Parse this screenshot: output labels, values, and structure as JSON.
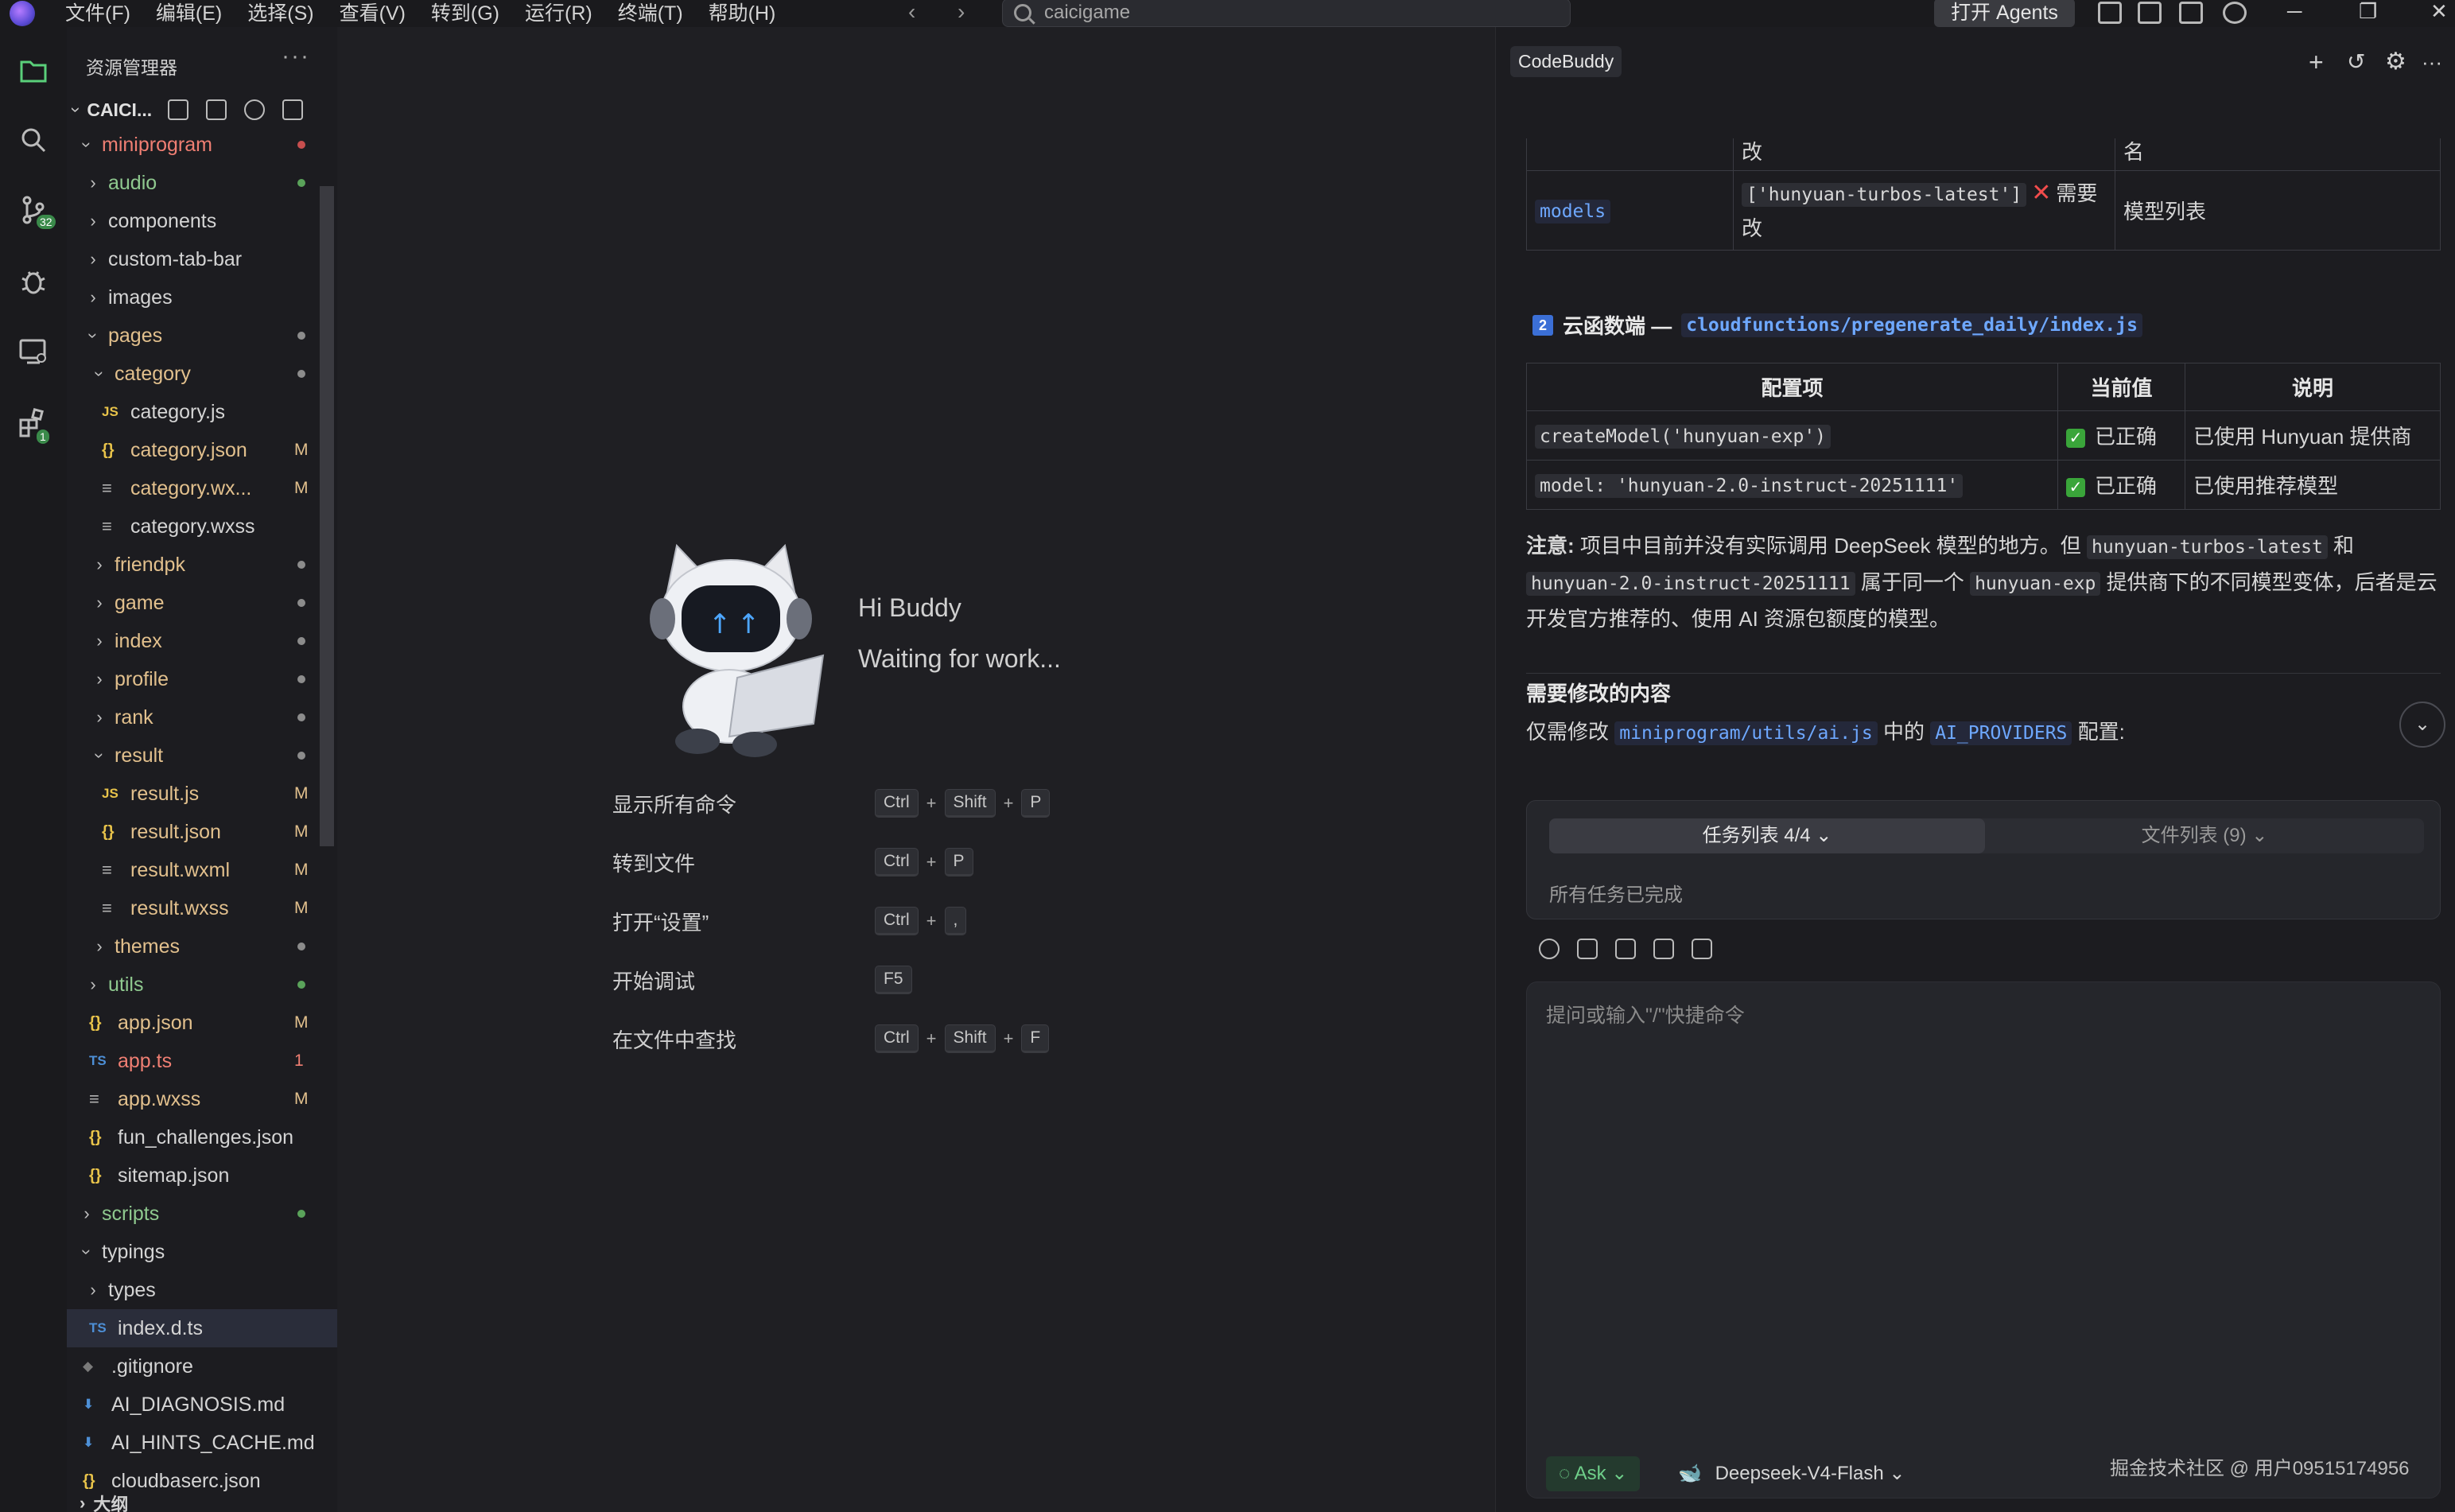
{
  "menu": [
    "文件(F)",
    "编辑(E)",
    "选择(S)",
    "查看(V)",
    "转到(G)",
    "运行(R)",
    "终端(T)",
    "帮助(H)"
  ],
  "search": {
    "text": "caicigame"
  },
  "agents_button": "打开 Agents",
  "activity": {
    "scm_badge": "32",
    "ext_badge": "1"
  },
  "explorer": {
    "title": "资源管理器",
    "project": "CAICI...",
    "outline": "大纲",
    "items": [
      {
        "label": "miniprogram",
        "depth": 1,
        "kind": "folder",
        "open": true,
        "color": "err",
        "mark": "dot-red"
      },
      {
        "label": "audio",
        "depth": 2,
        "kind": "folder",
        "color": "green",
        "mark": "dot-green"
      },
      {
        "label": "components",
        "depth": 2,
        "kind": "folder"
      },
      {
        "label": "custom-tab-bar",
        "depth": 2,
        "kind": "folder"
      },
      {
        "label": "images",
        "depth": 2,
        "kind": "folder"
      },
      {
        "label": "pages",
        "depth": 2,
        "kind": "folder",
        "open": true,
        "color": "mod",
        "mark": "dot"
      },
      {
        "label": "category",
        "depth": 3,
        "kind": "folder",
        "open": true,
        "color": "mod",
        "mark": "dot"
      },
      {
        "label": "category.js",
        "depth": 4,
        "kind": "js",
        "icon": "JS"
      },
      {
        "label": "category.json",
        "depth": 4,
        "kind": "json",
        "icon": "{}",
        "color": "mod",
        "status": "M"
      },
      {
        "label": "category.wx...",
        "depth": 4,
        "kind": "wx",
        "icon": "≡",
        "color": "mod",
        "status": "M"
      },
      {
        "label": "category.wxss",
        "depth": 4,
        "kind": "wx",
        "icon": "≡"
      },
      {
        "label": "friendpk",
        "depth": 3,
        "kind": "folder",
        "color": "mod",
        "mark": "dot"
      },
      {
        "label": "game",
        "depth": 3,
        "kind": "folder",
        "color": "mod",
        "mark": "dot"
      },
      {
        "label": "index",
        "depth": 3,
        "kind": "folder",
        "color": "mod",
        "mark": "dot"
      },
      {
        "label": "profile",
        "depth": 3,
        "kind": "folder",
        "color": "mod",
        "mark": "dot"
      },
      {
        "label": "rank",
        "depth": 3,
        "kind": "folder",
        "color": "mod",
        "mark": "dot"
      },
      {
        "label": "result",
        "depth": 3,
        "kind": "folder",
        "open": true,
        "color": "mod",
        "mark": "dot"
      },
      {
        "label": "result.js",
        "depth": 4,
        "kind": "js",
        "icon": "JS",
        "color": "mod",
        "status": "M"
      },
      {
        "label": "result.json",
        "depth": 4,
        "kind": "json",
        "icon": "{}",
        "color": "mod",
        "status": "M"
      },
      {
        "label": "result.wxml",
        "depth": 4,
        "kind": "wx",
        "icon": "≡",
        "color": "mod",
        "status": "M"
      },
      {
        "label": "result.wxss",
        "depth": 4,
        "kind": "wx",
        "icon": "≡",
        "color": "mod",
        "status": "M"
      },
      {
        "label": "themes",
        "depth": 3,
        "kind": "folder",
        "color": "mod",
        "mark": "dot"
      },
      {
        "label": "utils",
        "depth": 2,
        "kind": "folder",
        "color": "green",
        "mark": "dot-green"
      },
      {
        "label": "app.json",
        "depth": 2,
        "kind": "json",
        "icon": "{}",
        "color": "mod",
        "status": "M"
      },
      {
        "label": "app.ts",
        "depth": 2,
        "kind": "ts",
        "icon": "TS",
        "color": "err",
        "status": "1"
      },
      {
        "label": "app.wxss",
        "depth": 2,
        "kind": "wx",
        "icon": "≡",
        "color": "mod",
        "status": "M"
      },
      {
        "label": "fun_challenges.json",
        "depth": 2,
        "kind": "json",
        "icon": "{}"
      },
      {
        "label": "sitemap.json",
        "depth": 2,
        "kind": "json",
        "icon": "{}"
      },
      {
        "label": "scripts",
        "depth": 1,
        "kind": "folder",
        "color": "green",
        "mark": "dot-green"
      },
      {
        "label": "typings",
        "depth": 1,
        "kind": "folder",
        "open": true
      },
      {
        "label": "types",
        "depth": 2,
        "kind": "folder"
      },
      {
        "label": "index.d.ts",
        "depth": 2,
        "kind": "ts",
        "icon": "TS",
        "selected": true
      },
      {
        "label": ".gitignore",
        "depth": 1,
        "kind": "git",
        "icon": "◆"
      },
      {
        "label": "AI_DIAGNOSIS.md",
        "depth": 1,
        "kind": "md",
        "icon": "⬇"
      },
      {
        "label": "AI_HINTS_CACHE.md",
        "depth": 1,
        "kind": "md",
        "icon": "⬇"
      },
      {
        "label": "cloudbaserc.json",
        "depth": 1,
        "kind": "json",
        "icon": "{}"
      }
    ]
  },
  "welcome": {
    "greeting": "Hi Buddy",
    "status": "Waiting for work...",
    "shortcuts": [
      {
        "label": "显示所有命令",
        "keys": [
          "Ctrl",
          "Shift",
          "P"
        ]
      },
      {
        "label": "转到文件",
        "keys": [
          "Ctrl",
          "P"
        ]
      },
      {
        "label": "打开“设置”",
        "keys": [
          "Ctrl",
          ","
        ]
      },
      {
        "label": "开始调试",
        "keys": [
          "F5"
        ]
      },
      {
        "label": "在文件中查找",
        "keys": [
          "Ctrl",
          "Shift",
          "F"
        ]
      }
    ]
  },
  "panel": {
    "tab": "CodeBuddy",
    "table1": {
      "row_top": {
        "c2": "改",
        "c3": "名"
      },
      "row_models": {
        "key": "models",
        "value": "['hunyuan-turbos-latest']",
        "note": "需要改",
        "desc": "模型列表"
      }
    },
    "sec2": {
      "num": "2",
      "title": "云函数端 —",
      "path": "cloudfunctions/pregenerate_daily/index.js"
    },
    "table2": {
      "headers": [
        "配置项",
        "当前值",
        "说明"
      ],
      "rows": [
        {
          "item": "createModel('hunyuan-exp')",
          "value": "已正确",
          "desc": "已使用 Hunyuan 提供商"
        },
        {
          "item": "model: 'hunyuan-2.0-instruct-20251111'",
          "value": "已正确",
          "desc": "已使用推荐模型"
        }
      ]
    },
    "note": {
      "label": "注意:",
      "t1": "项目中目前并没有实际调用 DeepSeek 模型的地方。但",
      "c1": "hunyuan-turbos-latest",
      "t2": "和",
      "c2": "hunyuan-2.0-instruct-20251111",
      "t3": "属于同一个",
      "c3": "hunyuan-exp",
      "t4": "提供商下的不同模型变体，后者是云开发官方推荐的、使用 AI 资源包额度的模型。"
    },
    "modify": {
      "heading": "需要修改的内容",
      "t1": "仅需修改",
      "path": "miniprogram/utils/ai.js",
      "t2": "中的",
      "key": "AI_PROVIDERS",
      "t3": "配置:"
    },
    "tasks": {
      "tab_tasks": "任务列表 4/4",
      "tab_files": "文件列表 (9)",
      "done": "所有任务已完成"
    },
    "input": {
      "placeholder": "提问或输入\"/\"快捷命令"
    },
    "mode": "Ask",
    "model": "Deepseek-V4-Flash",
    "watermark": "掘金技术社区 @ 用户09515174956"
  }
}
